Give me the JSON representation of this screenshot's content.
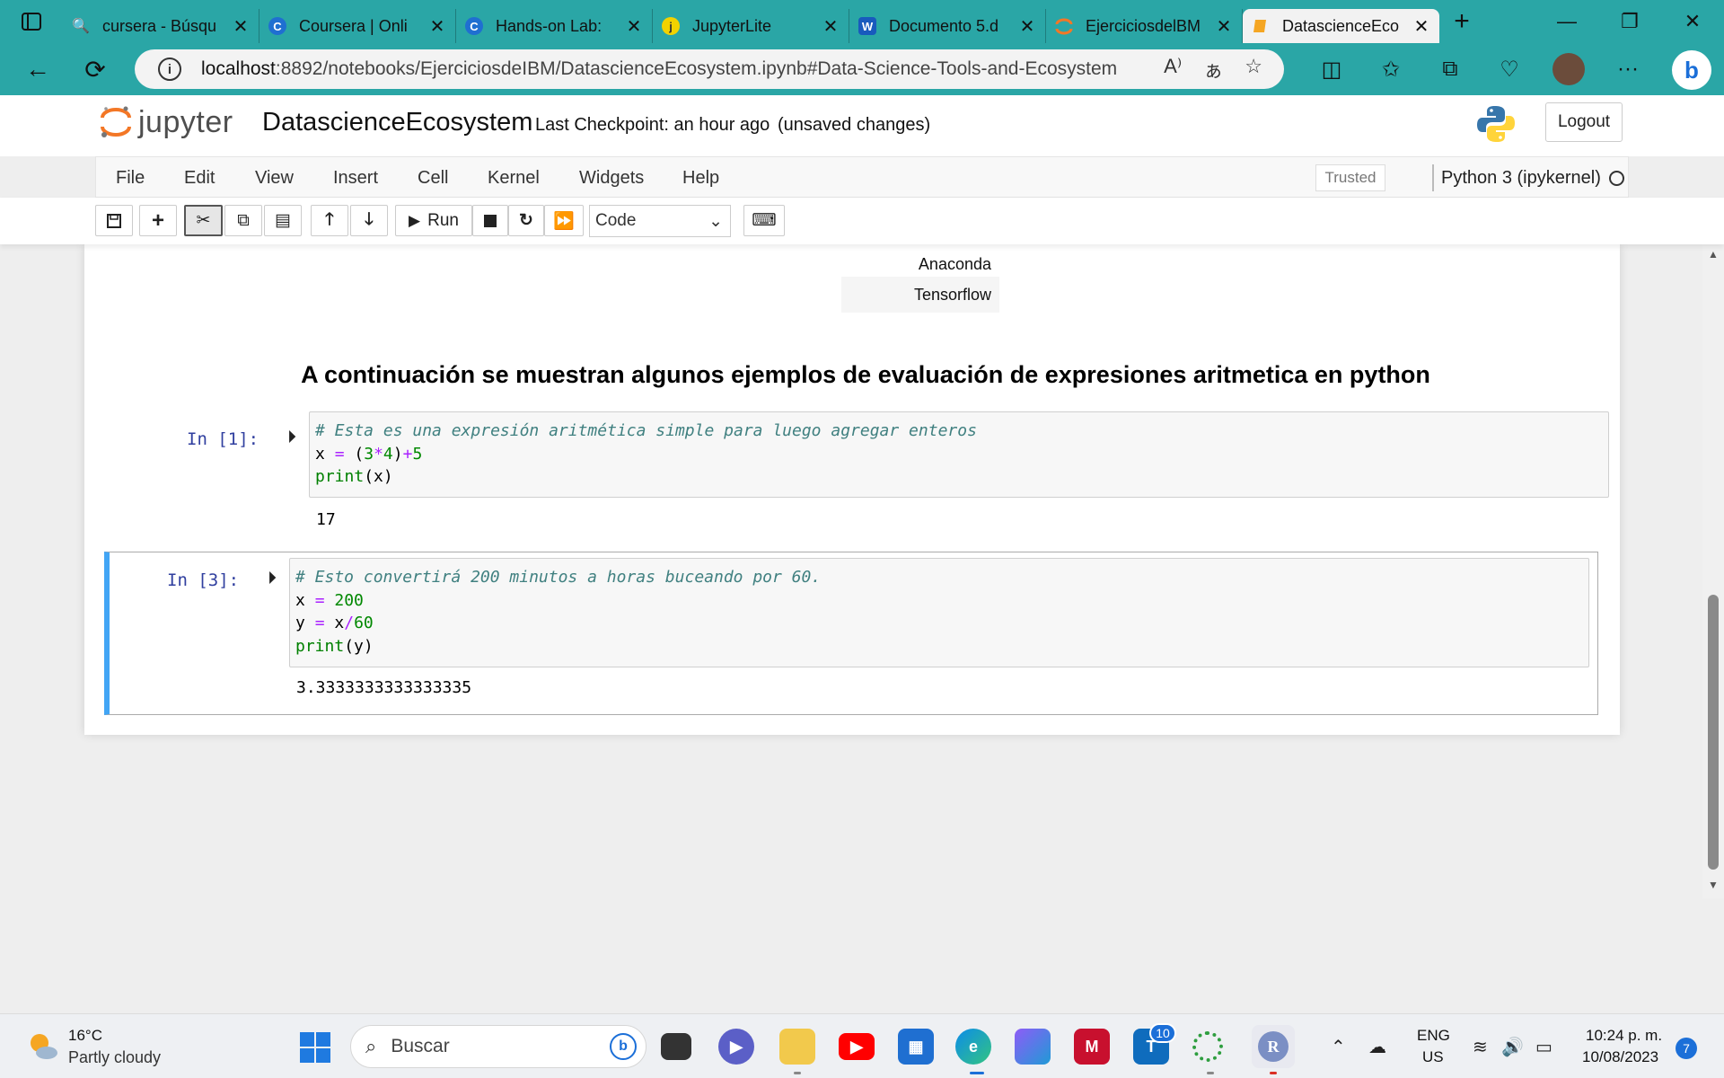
{
  "browser": {
    "tabs": [
      {
        "title": "cursera - Búsqu",
        "icon": "search-favicon",
        "color": "#2aa6a6"
      },
      {
        "title": "Coursera | Onli",
        "icon": "coursera-favicon",
        "color": "#1f6fd1"
      },
      {
        "title": "Hands-on Lab:",
        "icon": "coursera-favicon",
        "color": "#1f6fd1"
      },
      {
        "title": "JupyterLite",
        "icon": "jupyterlite-favicon",
        "color": "#f2d200"
      },
      {
        "title": "Documento 5.d",
        "icon": "word-favicon",
        "color": "#185abd"
      },
      {
        "title": "EjerciciosdelBM",
        "icon": "jupyter-favicon",
        "color": "#f37726"
      },
      {
        "title": "DatascienceEco",
        "icon": "notebook-favicon",
        "color": "#f5a623"
      }
    ],
    "url_host": "localhost",
    "url_rest": ":8892/notebooks/EjerciciosdeIBM/DatascienceEcosystem.ipynb#Data-Science-Tools-and-Ecosystem"
  },
  "jupyter": {
    "logo_text": "jupyter",
    "notebook_name": "DatascienceEcosystem",
    "checkpoint": "Last Checkpoint: an hour ago",
    "status": "(unsaved changes)",
    "logout_label": "Logout",
    "menu": [
      "File",
      "Edit",
      "View",
      "Insert",
      "Cell",
      "Kernel",
      "Widgets",
      "Help"
    ],
    "trusted_label": "Trusted",
    "kernel_name": "Python 3 (ipykernel)",
    "run_label": "Run",
    "cell_type": "Code"
  },
  "notebook": {
    "table_rows": [
      "Anaconda",
      "Tensorflow"
    ],
    "heading": "A continuación se muestran algunos ejemplos de evaluación de expresiones aritmetica en python",
    "cells": [
      {
        "prompt": "In [1]:",
        "comment": "# Esta es una expresión aritmética simple para luego agregar enteros",
        "output": "17"
      },
      {
        "prompt": "In [3]:",
        "comment": "# Esto convertirá 200 minutos a horas buceando por 60.",
        "output": "3.3333333333333335"
      }
    ]
  },
  "taskbar": {
    "temperature": "16°C",
    "weather": "Partly cloudy",
    "search_placeholder": "Buscar",
    "teams_badge": "10",
    "lang_line1": "ENG",
    "lang_line2": "US",
    "time": "10:24 p. m.",
    "date": "10/08/2023",
    "notification_count": "7"
  }
}
